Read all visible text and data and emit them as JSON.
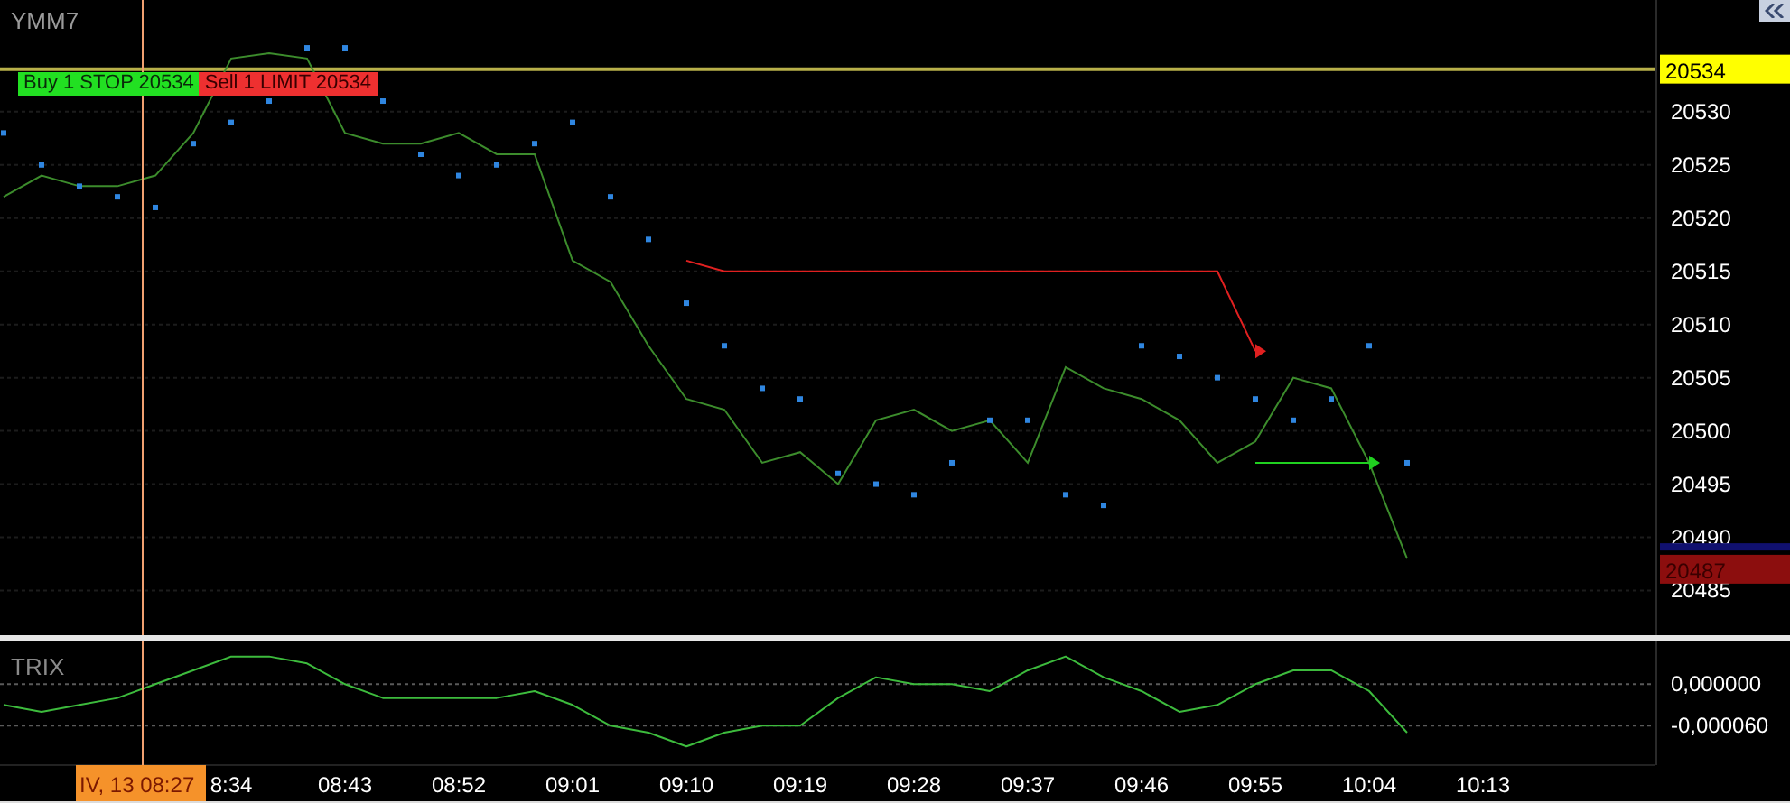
{
  "symbol": "YMM7",
  "orders": [
    {
      "kind": "buy",
      "label": "Buy 1 STOP 20534"
    },
    {
      "kind": "sell",
      "label": "Sell 1 LIMIT 20534"
    }
  ],
  "price_tags": [
    {
      "kind": "last",
      "label": "20534"
    },
    {
      "kind": "ask"
    },
    {
      "kind": "bid",
      "label": "20487"
    }
  ],
  "cursor": {
    "label": "IV, 13 08:27"
  },
  "price_chart": {
    "chart_data": {
      "type": "line",
      "grid": true,
      "ylim": [
        20480.8,
        20540.5
      ],
      "yticks": [
        20485,
        20490,
        20495,
        20500,
        20505,
        20510,
        20515,
        20520,
        20525,
        20530
      ],
      "ref_lines": [
        {
          "axis": "y",
          "value": 20534,
          "color": "#b8b04a"
        }
      ],
      "series": [
        {
          "type": "line",
          "color": "#3c8c2c",
          "values": [
            20522,
            20524,
            20523,
            20523,
            20524,
            20528,
            20535,
            20535.5,
            20535,
            20528,
            20527,
            20527,
            20528,
            20526,
            20526,
            20516,
            20514,
            20508,
            20503,
            20502,
            20497,
            20498,
            20495,
            20501,
            20502,
            20500,
            20501,
            20497,
            20506,
            20504,
            20503,
            20501,
            20497,
            20499,
            20505,
            20504,
            20497,
            20488
          ]
        },
        {
          "type": "scatter",
          "color": "#2f86e0",
          "values": [
            20528,
            20525,
            20523,
            20522,
            20521,
            20527,
            20529,
            20531,
            20536,
            20536,
            20531,
            20526,
            20524,
            20525,
            20527,
            20529,
            20522,
            20518,
            20512,
            20508,
            20504,
            20503,
            20496,
            20495,
            20494,
            20497,
            20501,
            20501,
            20494,
            20493,
            20508,
            20507,
            20505,
            20503,
            20501,
            20503,
            20508,
            20497
          ]
        },
        {
          "type": "line",
          "color": "#e02020",
          "values": [
            null,
            null,
            null,
            null,
            null,
            null,
            null,
            null,
            null,
            null,
            null,
            null,
            null,
            null,
            null,
            null,
            null,
            null,
            20516,
            20515,
            20515,
            20515,
            20515,
            20515,
            20515,
            20515,
            20515,
            20515,
            20515,
            20515,
            20515,
            20515,
            20515,
            20507.5
          ]
        },
        {
          "type": "line",
          "color": "#20d020",
          "values": [
            null,
            null,
            null,
            null,
            null,
            null,
            null,
            null,
            null,
            null,
            null,
            null,
            null,
            null,
            null,
            null,
            null,
            null,
            null,
            null,
            null,
            null,
            null,
            null,
            null,
            null,
            null,
            null,
            null,
            null,
            null,
            null,
            null,
            20497,
            20497,
            20497,
            20497
          ]
        }
      ]
    }
  },
  "indicator": {
    "name": "TRIX",
    "chart_data": {
      "type": "line",
      "grid": true,
      "ylim": [
        -0.000117,
        6.3e-05
      ],
      "yticks": [
        {
          "value": 0,
          "label": "0,000000"
        },
        {
          "value": -6e-05,
          "label": "-0,000060"
        }
      ],
      "categories": [
        null,
        null,
        null,
        null,
        null,
        null,
        "8:34",
        null,
        null,
        "08:43",
        null,
        null,
        "08:52",
        null,
        null,
        "09:01",
        null,
        null,
        "09:10",
        null,
        null,
        "09:19",
        null,
        null,
        "09:28",
        null,
        null,
        "09:37",
        null,
        null,
        "09:46",
        null,
        null,
        "09:55",
        null,
        null,
        "10:04",
        null,
        null,
        "10:13",
        null,
        null,
        null,
        null
      ],
      "series": [
        {
          "color": "#3dbb3d",
          "values": [
            -3e-05,
            -4e-05,
            -3e-05,
            -2e-05,
            0,
            2e-05,
            4e-05,
            4e-05,
            3e-05,
            0,
            -2e-05,
            -2e-05,
            -2e-05,
            -2e-05,
            -1e-05,
            -3e-05,
            -6e-05,
            -7e-05,
            -9e-05,
            -7e-05,
            -6e-05,
            -6e-05,
            -2e-05,
            1e-05,
            0,
            0,
            -1e-05,
            2e-05,
            4e-05,
            1e-05,
            -1e-05,
            -4e-05,
            -3e-05,
            0,
            2e-05,
            2e-05,
            -1e-05,
            -7e-05,
            null,
            null,
            null,
            null,
            null,
            null
          ]
        }
      ]
    }
  }
}
